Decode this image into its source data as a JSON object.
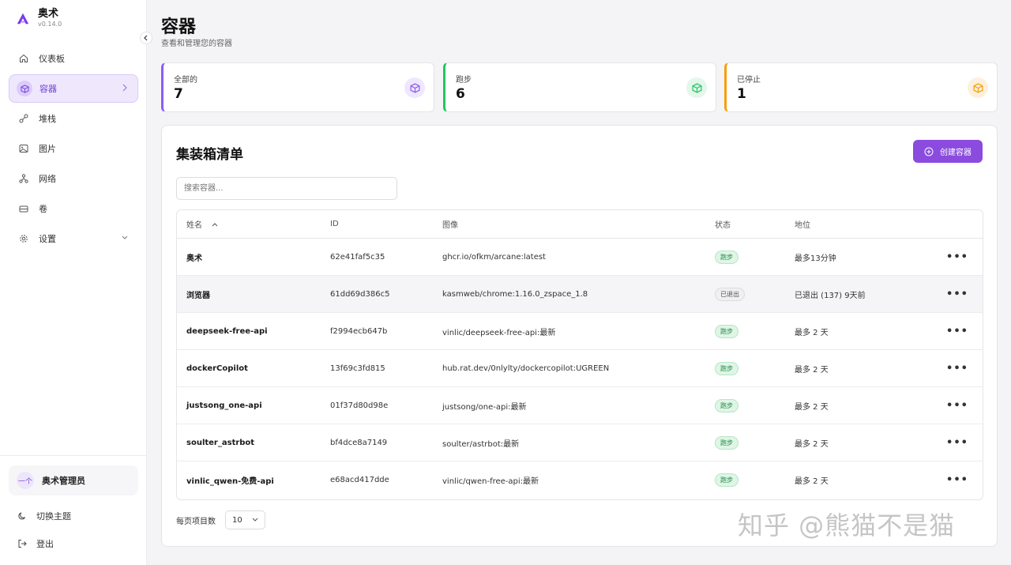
{
  "app": {
    "name": "奥术",
    "version": "v0.14.0"
  },
  "sidebar": {
    "items": [
      {
        "label": "仪表板",
        "icon": "home-icon"
      },
      {
        "label": "容器",
        "icon": "box-icon",
        "active": true
      },
      {
        "label": "堆栈",
        "icon": "stack-icon"
      },
      {
        "label": "图片",
        "icon": "image-icon"
      },
      {
        "label": "网络",
        "icon": "network-icon"
      },
      {
        "label": "卷",
        "icon": "volume-icon"
      },
      {
        "label": "设置",
        "icon": "gear-icon"
      }
    ],
    "user": {
      "avatar_text": "一个",
      "name": "奥术管理员"
    },
    "theme_label": "切换主题",
    "logout_label": "登出"
  },
  "header": {
    "title": "容器",
    "subtitle": "查看和管理您的容器"
  },
  "stats": [
    {
      "label": "全部的",
      "value": "7",
      "color": "#8b5cf6"
    },
    {
      "label": "跑步",
      "value": "6",
      "color": "#22c55e"
    },
    {
      "label": "已停止",
      "value": "1",
      "color": "#f59e0b"
    }
  ],
  "panel": {
    "title": "集装箱清单",
    "create_label": "创建容器",
    "search_placeholder": "搜索容器..."
  },
  "table": {
    "headers": {
      "name": "姓名",
      "id": "ID",
      "image": "图像",
      "state": "状态",
      "status": "地位"
    },
    "rows": [
      {
        "name": "奥术",
        "id": "62e41faf5c35",
        "image": "ghcr.io/ofkm/arcane:latest",
        "state": "跑步",
        "state_kind": "running",
        "status": "最多13分钟"
      },
      {
        "name": "浏览器",
        "id": "61dd69d386c5",
        "image": "kasmweb/chrome:1.16.0_zspace_1.8",
        "state": "已退出",
        "state_kind": "exited",
        "status": "已退出 (137) 9天前"
      },
      {
        "name": "deepseek-free-api",
        "id": "f2994ecb647b",
        "image": "vinlic/deepseek-free-api:最新",
        "state": "跑步",
        "state_kind": "running",
        "status": "最多 2 天"
      },
      {
        "name": "dockerCopilot",
        "id": "13f69c3fd815",
        "image": "hub.rat.dev/0nlylty/dockercopilot:UGREEN",
        "state": "跑步",
        "state_kind": "running",
        "status": "最多 2 天"
      },
      {
        "name": "justsong_one-api",
        "id": "01f37d80d98e",
        "image": "justsong/one-api:最新",
        "state": "跑步",
        "state_kind": "running",
        "status": "最多 2 天"
      },
      {
        "name": "soulter_astrbot",
        "id": "bf4dce8a7149",
        "image": "soulter/astrbot:最新",
        "state": "跑步",
        "state_kind": "running",
        "status": "最多 2 天"
      },
      {
        "name": "vinlic_qwen-免费-api",
        "id": "e68acd417dde",
        "image": "vinlic/qwen-free-api:最新",
        "state": "跑步",
        "state_kind": "running",
        "status": "最多 2 天"
      }
    ],
    "actions_label": "•••"
  },
  "pager": {
    "label": "每页项目数",
    "value": "10"
  },
  "watermark": "知乎 @熊猫不是猫"
}
